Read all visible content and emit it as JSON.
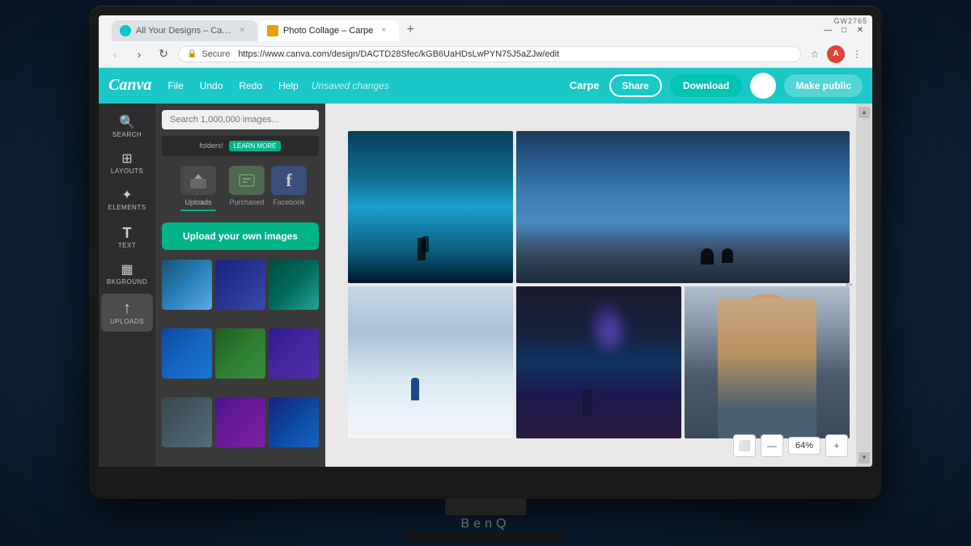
{
  "monitor": {
    "brand": "BenQ",
    "model_label": "GW2765"
  },
  "browser": {
    "tabs": [
      {
        "label": "All Your Designs – Canva",
        "favicon_color": "#00c8c8",
        "active": false
      },
      {
        "label": "Photo Collage – Carpe",
        "favicon_color": "#e8a000",
        "active": true
      }
    ],
    "new_tab_symbol": "+",
    "back_disabled": false,
    "forward_disabled": true,
    "reload_symbol": "↻",
    "secure_label": "Secure",
    "url": "https://www.canva.com/design/DACTD28Sfec/kGB6UaHDsLwPYN75J5aZJw/edit",
    "star_symbol": "☆",
    "menu_symbol": "⋮",
    "window_controls": {
      "minimize": "—",
      "maximize": "□",
      "close": "✕"
    }
  },
  "canva": {
    "logo": "Canva",
    "menu": {
      "file": "File",
      "undo": "Undo",
      "redo": "Redo",
      "help": "Help"
    },
    "unsaved": "Unsaved changes",
    "user": "Carpe",
    "share_btn": "Share",
    "download_btn": "Download",
    "make_public_btn": "Make public"
  },
  "sidebar": {
    "items": [
      {
        "label": "SEARCH",
        "icon": "🔍"
      },
      {
        "label": "LAYOUTS",
        "icon": "⊞"
      },
      {
        "label": "ELEMENTS",
        "icon": "✦"
      },
      {
        "label": "TEXT",
        "icon": "T"
      },
      {
        "label": "BKGROUND",
        "icon": "▦"
      },
      {
        "label": "UPLOADS",
        "icon": "↑"
      }
    ]
  },
  "panel": {
    "search_placeholder": "Search 1,000,000 images...",
    "banner_text": "folders!",
    "learn_more": "LEARN MORE",
    "sources": [
      {
        "label": "Uploads",
        "active": true
      },
      {
        "label": "Purchased",
        "active": false
      },
      {
        "label": "Facebook",
        "active": false
      }
    ],
    "upload_btn": "Upload your own images",
    "thumbs": [
      "thumb-1",
      "thumb-2",
      "thumb-3",
      "thumb-4",
      "thumb-5",
      "thumb-6",
      "thumb-7",
      "thumb-8",
      "thumb-9"
    ]
  },
  "canvas": {
    "zoom_level": "64%",
    "zoom_in": "+",
    "zoom_out": "—",
    "page_number": "1"
  },
  "collage": {
    "images": [
      {
        "id": "cave",
        "alt": "Ice cave with person"
      },
      {
        "id": "cliff",
        "alt": "Cliff silhouette foggy"
      },
      {
        "id": "snow",
        "alt": "Person in snow with blue jacket"
      },
      {
        "id": "smoke",
        "alt": "Person with blue smoke"
      },
      {
        "id": "portrait",
        "alt": "Woman portrait close-up"
      }
    ]
  }
}
